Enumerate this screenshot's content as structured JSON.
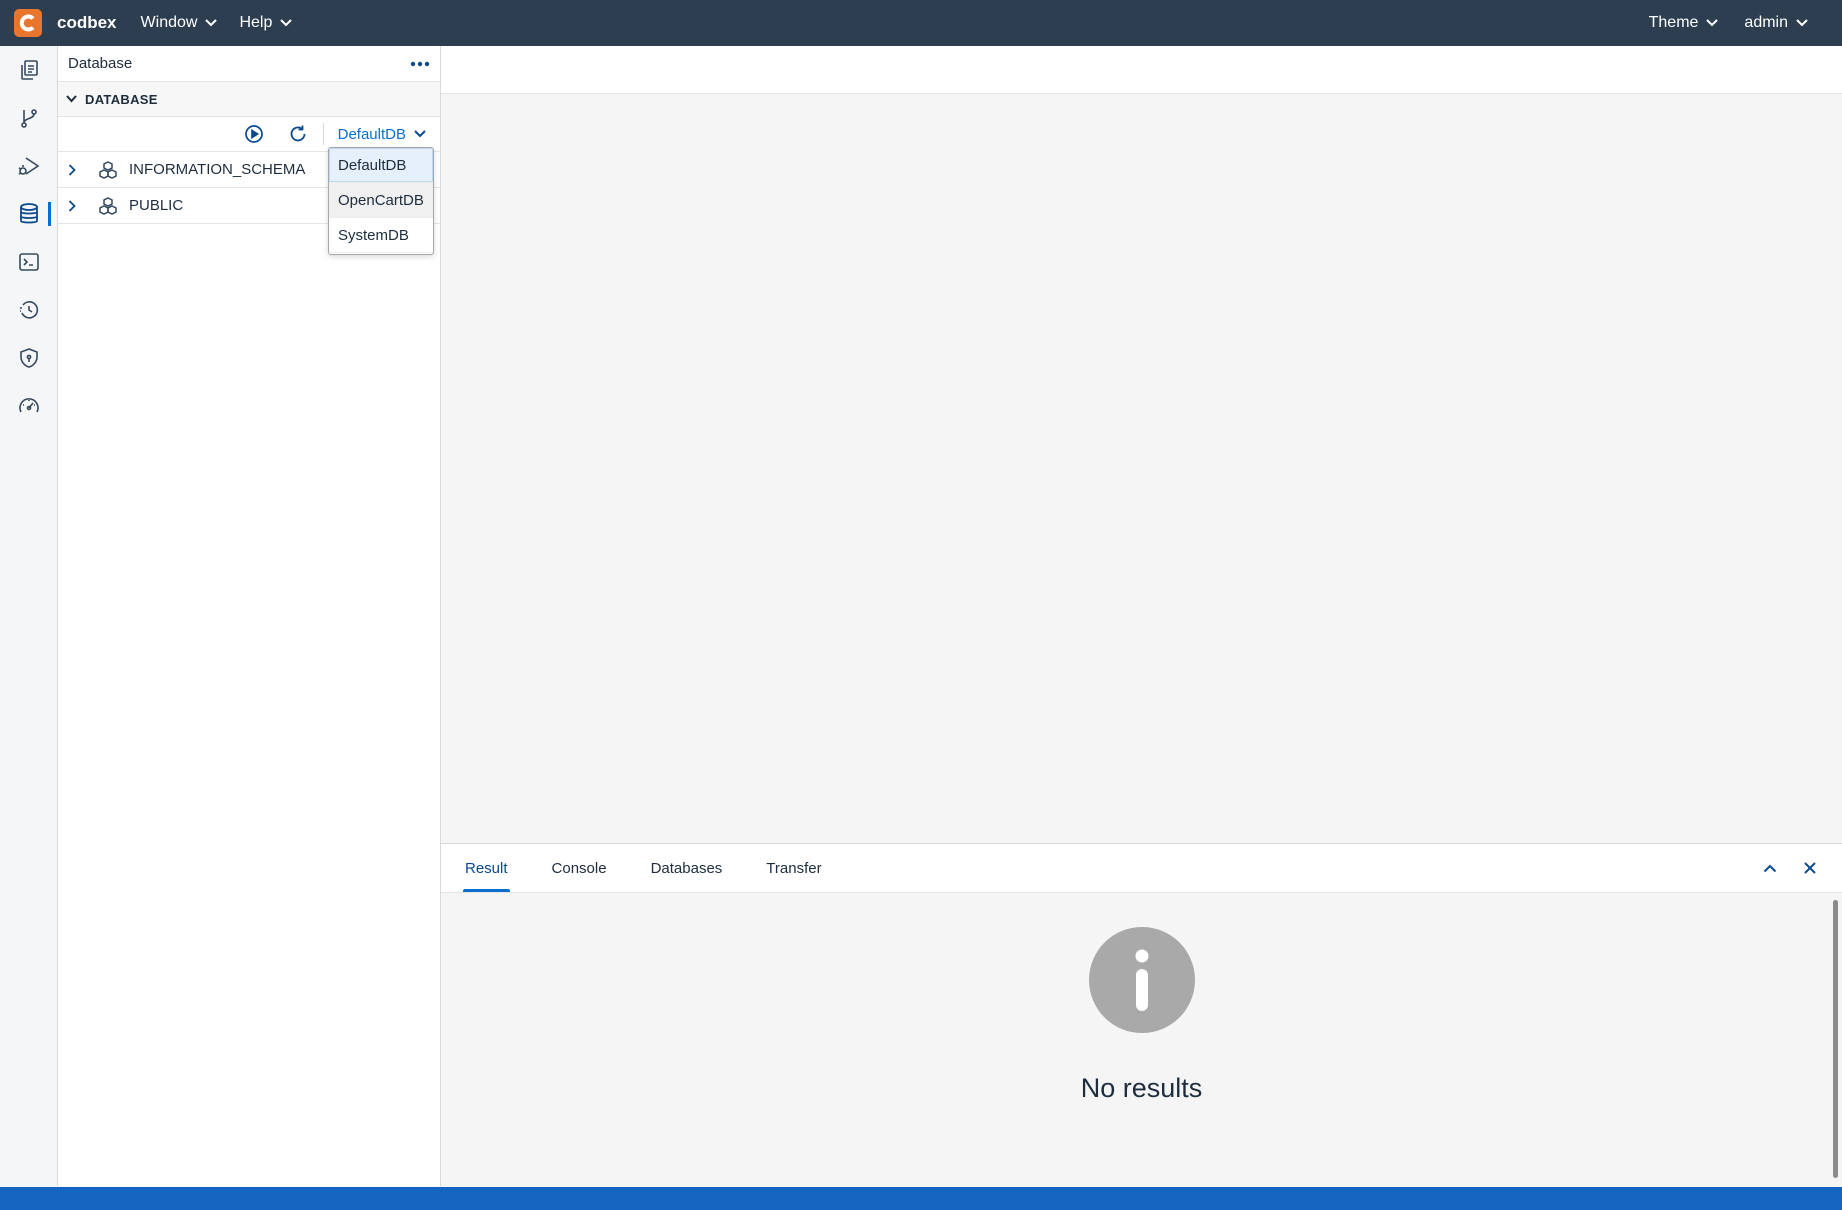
{
  "shell": {
    "brand": "codbex",
    "menus": [
      {
        "label": "Window"
      },
      {
        "label": "Help"
      }
    ],
    "right_menus": [
      {
        "label": "Theme"
      },
      {
        "label": "admin"
      }
    ]
  },
  "activity_bar": {
    "items": [
      {
        "name": "documents-icon",
        "active": false
      },
      {
        "name": "git-branch-icon",
        "active": false
      },
      {
        "name": "debug-run-icon",
        "active": false
      },
      {
        "name": "database-icon",
        "active": true
      },
      {
        "name": "terminal-icon",
        "active": false
      },
      {
        "name": "history-icon",
        "active": false
      },
      {
        "name": "shield-icon",
        "active": false
      },
      {
        "name": "gauge-icon",
        "active": false
      }
    ]
  },
  "sidebar": {
    "title": "Database",
    "section_title": "DATABASE",
    "selected_db": "DefaultDB",
    "tree": [
      {
        "label": "INFORMATION_SCHEMA"
      },
      {
        "label": "PUBLIC"
      }
    ]
  },
  "dropdown": {
    "options": [
      {
        "label": "DefaultDB",
        "state": "selected"
      },
      {
        "label": "OpenCartDB",
        "state": "hover"
      },
      {
        "label": "SystemDB",
        "state": "normal"
      }
    ]
  },
  "bottom_panel": {
    "tabs": [
      {
        "label": "Result",
        "active": true
      },
      {
        "label": "Console",
        "active": false
      },
      {
        "label": "Databases",
        "active": false
      },
      {
        "label": "Transfer",
        "active": false
      }
    ],
    "empty_message": "No results"
  },
  "colors": {
    "shellbar": "#2c3e50",
    "logo": "#e8762c",
    "accent": "#0a6ed1",
    "statusbar": "#1565c0"
  }
}
